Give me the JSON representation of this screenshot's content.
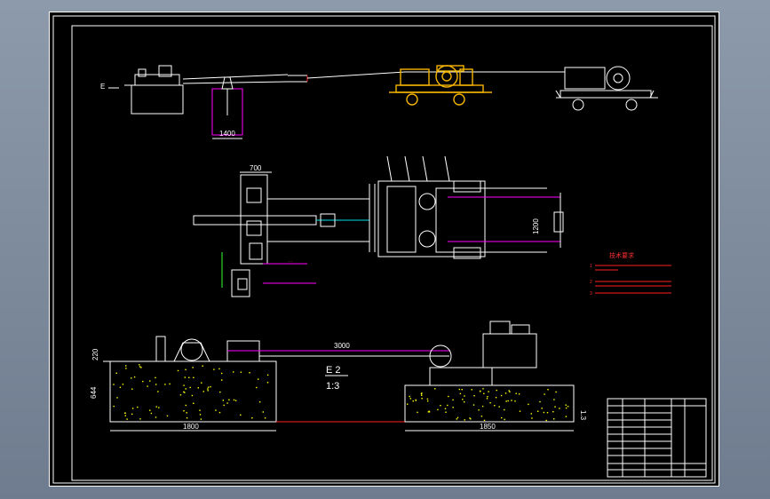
{
  "views": {
    "top_left_label": "E",
    "top_dimension": "1400",
    "plan_width_dimension": "700",
    "plan_height_dimension": "1200",
    "elevation_span_dimension": "3000",
    "left_height_dimension": "220",
    "left_base_height_dimension": "644",
    "right_base_height_dimension": "1.3",
    "left_base_width_dimension": "1800",
    "right_base_width_dimension": "1850",
    "detail_label": "E 2",
    "detail_scale": "1:3"
  },
  "notes": {
    "title": "技术要求",
    "lines": [
      "1",
      "2",
      "3"
    ]
  },
  "colors": {
    "background": "#000000",
    "line": "#ffffff",
    "equipment": "#f4b400",
    "dimension": "#ff00ff",
    "hydraulic": "#00e5ee",
    "notes": "#ff3030",
    "concrete_fill": "#ffff00"
  }
}
